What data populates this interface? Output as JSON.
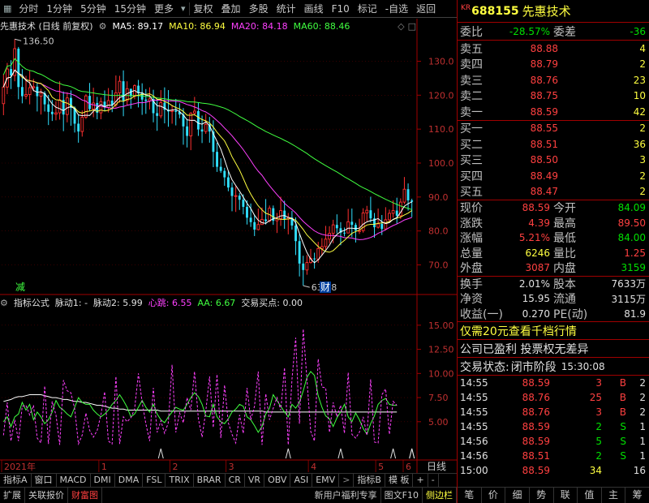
{
  "toolbar": {
    "buttons": [
      "分时",
      "1分钟",
      "5分钟",
      "15分钟",
      "更多",
      "复权",
      "叠加",
      "多股",
      "统计",
      "画线",
      "F10",
      "标记",
      "-自选",
      "返回"
    ]
  },
  "chart": {
    "title": "先惠技术 (日线 前复权)",
    "ma": [
      {
        "label": "MA5: 89.17",
        "color": "#ffffff"
      },
      {
        "label": "MA10: 86.94",
        "color": "#ffff40"
      },
      {
        "label": "MA20: 84.18",
        "color": "#ff40ff"
      },
      {
        "label": "MA60: 88.46",
        "color": "#40ff40"
      }
    ],
    "high_label": "136.50",
    "low_label": "63.88",
    "marker_left": "减",
    "marker_right": "财"
  },
  "sub_chart": {
    "title": "指标公式",
    "items": [
      {
        "label": "脉动1: -",
        "color": "#e0e0e0"
      },
      {
        "label": "脉动2: 5.99",
        "color": "#e0e0e0"
      },
      {
        "label": "心跳: 6.55",
        "color": "#ff40ff"
      },
      {
        "label": "AA: 6.67",
        "color": "#40ff40"
      },
      {
        "label": "交易买点: 0.00",
        "color": "#e0e0e0"
      }
    ]
  },
  "chart_data": {
    "type": "candlestick",
    "main_yaxis_ticks": [
      130,
      120,
      110,
      100,
      90,
      80,
      70
    ],
    "main_ylim": [
      62,
      138
    ],
    "sub_yaxis_ticks": [
      15,
      12.5,
      10,
      7.5,
      5
    ],
    "sub_ylim": [
      1.2,
      16.5
    ],
    "x_labels": [
      "2021年",
      "1",
      "2",
      "3",
      "4",
      "5",
      "6"
    ],
    "x_axis_label": "日线",
    "candles": [
      [
        117.5,
        122.4,
        126.2,
        114.1
      ],
      [
        122.4,
        127.7,
        129.5,
        120.3
      ],
      [
        127.7,
        125.8,
        130.3,
        121.8
      ],
      [
        125.8,
        133.7,
        136.5,
        124.1
      ],
      [
        133.7,
        122.4,
        134.2,
        118.8
      ],
      [
        122.4,
        119.7,
        127.7,
        117.6
      ],
      [
        119.7,
        120.2,
        125.7,
        118.8
      ],
      [
        120.2,
        122.2,
        127.3,
        117.3
      ],
      [
        122.2,
        122.5,
        124.8,
        121.1
      ],
      [
        122.5,
        119.7,
        123.6,
        115.2
      ],
      [
        119.7,
        120.6,
        121.9,
        114.3
      ],
      [
        120.6,
        117.3,
        121.2,
        115.2
      ],
      [
        117.3,
        115.1,
        120.1,
        111.2
      ],
      [
        115.1,
        114.4,
        118.6,
        112.4
      ],
      [
        114.4,
        114.8,
        118.2,
        112.6
      ],
      [
        114.8,
        118.6,
        124.1,
        112.8
      ],
      [
        118.6,
        114.3,
        121.1,
        109.4
      ],
      [
        114.3,
        119.2,
        120.8,
        112.0
      ],
      [
        119.2,
        116.3,
        121.4,
        111.0
      ],
      [
        116.3,
        111.6,
        116.7,
        109.0
      ],
      [
        111.6,
        109.3,
        114.2,
        106.0
      ],
      [
        109.3,
        113.5,
        115.5,
        107.8
      ],
      [
        113.5,
        119.8,
        120.3,
        113.0
      ],
      [
        119.8,
        115.9,
        123.6,
        115.3
      ],
      [
        115.9,
        117.7,
        122.2,
        113.5
      ],
      [
        117.7,
        114.8,
        119.5,
        112.9
      ],
      [
        114.8,
        118.1,
        119.3,
        112.9
      ],
      [
        118.1,
        116.4,
        121.4,
        115.4
      ],
      [
        116.4,
        118.4,
        122.1,
        114.9
      ],
      [
        118.4,
        117.1,
        121.5,
        115.0
      ],
      [
        117.1,
        120.7,
        125.8,
        116.4
      ],
      [
        120.7,
        124.1,
        125.7,
        117.8
      ],
      [
        124.1,
        118.4,
        127.3,
        113.8
      ],
      [
        118.4,
        121.9,
        124.1,
        117.1
      ],
      [
        121.9,
        119.7,
        121.6,
        116.0
      ],
      [
        119.7,
        122.8,
        123.2,
        118.8
      ],
      [
        122.8,
        120.6,
        124.5,
        116.4
      ],
      [
        120.6,
        118.7,
        123.5,
        114.2
      ],
      [
        118.7,
        118.3,
        121.8,
        114.5
      ],
      [
        118.3,
        118.9,
        122.3,
        115.8
      ],
      [
        118.9,
        114.7,
        121.6,
        112.0
      ],
      [
        114.7,
        113.9,
        119.0,
        109.5
      ],
      [
        113.9,
        117.8,
        121.5,
        113.2
      ],
      [
        117.8,
        115.7,
        122.3,
        111.7
      ],
      [
        115.7,
        115.2,
        121.5,
        110.7
      ],
      [
        115.2,
        115.5,
        117.1,
        111.6
      ],
      [
        115.5,
        115.1,
        118.9,
        111.1
      ],
      [
        115.1,
        114.3,
        117.6,
        113.2
      ],
      [
        114.3,
        110.8,
        116.2,
        105.4
      ],
      [
        110.8,
        108.0,
        113.0,
        104.6
      ],
      [
        108.0,
        114.7,
        115.0,
        103.8
      ],
      [
        114.7,
        115.3,
        119.5,
        114.0
      ],
      [
        115.3,
        109.9,
        117.9,
        108.0
      ],
      [
        109.9,
        109.3,
        114.0,
        105.9
      ],
      [
        109.3,
        111.4,
        114.5,
        108.6
      ],
      [
        111.4,
        109.3,
        113.6,
        106.0
      ],
      [
        109.3,
        103.3,
        112.6,
        98.8
      ],
      [
        103.3,
        98.9,
        106.0,
        97.4
      ],
      [
        98.9,
        97.7,
        101.4,
        97.1
      ],
      [
        97.7,
        95.8,
        98.6,
        93.3
      ],
      [
        95.8,
        92.8,
        97.5,
        91.7
      ],
      [
        92.8,
        90.3,
        94.3,
        85.8
      ],
      [
        90.3,
        90.4,
        93.2,
        85.6
      ],
      [
        90.4,
        89.2,
        91.2,
        86.2
      ],
      [
        89.2,
        87.1,
        90.8,
        84.9
      ],
      [
        87.1,
        83.9,
        89.0,
        81.9
      ],
      [
        83.9,
        82.6,
        88.1,
        81.2
      ],
      [
        82.6,
        80.4,
        84.7,
        78.5
      ],
      [
        80.4,
        81.9,
        86.6,
        80.2
      ],
      [
        81.9,
        83.4,
        86.9,
        81.8
      ],
      [
        83.4,
        82.9,
        89.4,
        81.9
      ],
      [
        82.9,
        86.7,
        87.5,
        82.5
      ],
      [
        86.7,
        83.0,
        87.5,
        81.8
      ],
      [
        83.0,
        83.6,
        85.3,
        79.4
      ],
      [
        83.6,
        86.0,
        90.1,
        81.5
      ],
      [
        86.0,
        83.5,
        88.9,
        80.6
      ],
      [
        83.5,
        83.9,
        85.3,
        79.0
      ],
      [
        83.9,
        81.6,
        85.9,
        80.4
      ],
      [
        81.6,
        77.0,
        84.0,
        72.9
      ],
      [
        77.0,
        70.4,
        79.0,
        66.6
      ],
      [
        70.4,
        68.5,
        72.7,
        63.9
      ],
      [
        68.5,
        70.7,
        72.9,
        67.1
      ],
      [
        70.7,
        71.9,
        74.7,
        70.4
      ],
      [
        71.9,
        71.7,
        73.6,
        68.9
      ],
      [
        71.7,
        74.8,
        76.8,
        70.6
      ],
      [
        74.8,
        75.4,
        77.9,
        72.7
      ],
      [
        75.4,
        77.6,
        81.5,
        74.4
      ],
      [
        77.6,
        79.3,
        81.4,
        76.3
      ],
      [
        79.3,
        81.8,
        83.3,
        76.4
      ],
      [
        81.8,
        80.8,
        84.9,
        79.3
      ],
      [
        80.8,
        79.5,
        82.6,
        75.8
      ],
      [
        79.5,
        79.4,
        81.0,
        78.4
      ],
      [
        79.4,
        82.7,
        86.5,
        80.1
      ],
      [
        82.7,
        81.8,
        86.6,
        78.2
      ],
      [
        81.8,
        80.1,
        82.4,
        76.6
      ],
      [
        80.1,
        80.1,
        83.6,
        79.1
      ],
      [
        80.1,
        85.3,
        86.7,
        79.5
      ],
      [
        85.3,
        86.1,
        87.4,
        82.8
      ],
      [
        86.1,
        83.7,
        90.1,
        82.5
      ],
      [
        83.7,
        81.1,
        85.3,
        78.0
      ],
      [
        81.1,
        82.1,
        86.6,
        80.7
      ],
      [
        82.1,
        80.6,
        84.7,
        78.8
      ],
      [
        80.6,
        83.3,
        87.0,
        80.2
      ],
      [
        83.3,
        85.2,
        86.3,
        82.5
      ],
      [
        85.2,
        86.0,
        89.0,
        83.9
      ],
      [
        86.0,
        84.5,
        89.8,
        82.1
      ],
      [
        84.5,
        88.5,
        89.6,
        83.5
      ],
      [
        88.5,
        92.3,
        95.9,
        87.9
      ],
      [
        92.3,
        89.0,
        94.0,
        86.0
      ],
      [
        89.0,
        88.6,
        89.5,
        84.1
      ]
    ],
    "ma5_color": "#ffffff",
    "ma10_color": "#ffff40",
    "ma20_color": "#ff40ff",
    "ma60_color": "#40ff40",
    "sub_series": {
      "xintiao": [
        3.6,
        7.0,
        3.0,
        5.2,
        3.0,
        6.6,
        6.7,
        5.7,
        6.7,
        3.3,
        2.8,
        8.7,
        2.7,
        7.1,
        5.7,
        2.6,
        9.3,
        8.2,
        8.0,
        6.3,
        2.7,
        3.6,
        5.9,
        4.1,
        3.4,
        4.1,
        5.7,
        8.1,
        3.0,
        2.7,
        9.7,
        2.7,
        5.5,
        5.0,
        5.4,
        6.3,
        10.0,
        7.0,
        4.8,
        3.0,
        8.5,
        3.9,
        5.1,
        3.8,
        4.9,
        10.9,
        3.9,
        5.9,
        4.9,
        7.5,
        6.2,
        10.2,
        5.3,
        3.4,
        6.1,
        9.7,
        4.4,
        9.9,
        3.3,
        8.8,
        4.9,
        3.7,
        2.8,
        5.7,
        3.8,
        8.5,
        5.2,
        6.6,
        10.2,
        2.6,
        7.9,
        5.2,
        6.4,
        7.5,
        6.2,
        10.6,
        2.6,
        9.4,
        13.7,
        4.8,
        14.6,
        9.3,
        4.0,
        3.0,
        11.5,
        8.6,
        8.5,
        3.9,
        7.0,
        5.5,
        6.7,
        3.8,
        10.1,
        3.7,
        3.3,
        3.9,
        5.5,
        3.6,
        9.4,
        2.9,
        2.8,
        7.8,
        8.4,
        3.7,
        7.1,
        6.7
      ],
      "aa": [
        5.0,
        5.5,
        4.5,
        5.5,
        5.8,
        7.0,
        6.2,
        6.8,
        5.2,
        6.0,
        5.5,
        4.8,
        5.2,
        6.0,
        7.2,
        6.5,
        6.2,
        5.8,
        5.5,
        6.5,
        7.5,
        7.0,
        6.8,
        6.8,
        6.2,
        5.8,
        5.5,
        5.8,
        6.2,
        6.8,
        7.2,
        7.8,
        7.2,
        6.5,
        5.5,
        5.8,
        6.5,
        7.2,
        6.5,
        6.0,
        6.8,
        5.8,
        5.2,
        4.9,
        5.5,
        6.0,
        6.5,
        6.3,
        6.2,
        6.8,
        7.5,
        8.0,
        7.6,
        6.8,
        5.6,
        5.5,
        6.8,
        5.5,
        5.0,
        4.8,
        5.3,
        6.0,
        6.3,
        6.8,
        6.6,
        5.5,
        5.2,
        4.6,
        3.9,
        4.5,
        5.8,
        6.4,
        7.8,
        7.2,
        6.6,
        6.0,
        5.5,
        6.8,
        6.4,
        7.0,
        8.2,
        9.6,
        10.2,
        9.8,
        7.7,
        6.5,
        5.6,
        5.3,
        4.5,
        5.4,
        6.0,
        6.8,
        5.5,
        5.0,
        5.9,
        5.2,
        4.3,
        3.7,
        4.8,
        5.6,
        6.8,
        7.2,
        7.4,
        6.8,
        6.7,
        6.7
      ],
      "maidong": [
        7.1,
        7.2,
        7.3,
        7.5,
        7.6,
        7.6,
        7.7,
        7.8,
        7.8,
        7.8,
        7.8,
        7.7,
        7.6,
        7.5,
        7.5,
        7.4,
        7.3,
        7.3,
        7.2,
        7.1,
        7.1,
        7.0,
        7.0,
        6.9,
        6.8,
        6.7,
        6.7,
        6.6,
        6.5,
        6.4,
        6.4,
        6.3,
        6.3,
        6.2,
        6.2,
        6.2,
        6.2,
        6.2,
        6.2,
        6.2,
        6.2,
        6.2,
        6.1,
        6.1,
        6.1,
        6.1,
        6.1,
        6.1,
        6.1,
        6.1,
        6.1,
        6.1,
        6.1,
        6.1,
        6.1,
        6.1,
        6.1,
        6.1,
        6.1,
        6.1,
        6.1,
        6.1,
        6.1,
        6.1,
        6.1,
        6.1,
        6.1,
        6.1,
        6.1,
        6.1,
        6.0,
        6.0,
        6.0,
        6.0,
        6.0,
        6.0,
        6.0,
        6.0,
        6.0,
        6.0,
        6.0,
        6.0,
        6.0,
        6.0,
        6.0,
        6.0,
        6.0,
        6.0,
        6.0,
        6.0,
        6.0,
        6.0,
        6.0,
        6.0,
        6.0,
        6.0,
        6.0,
        6.0,
        6.0,
        6.0,
        6.0,
        6.0,
        6.0,
        6.0,
        6.0,
        6.0
      ]
    }
  },
  "bottom_tabs_row1": [
    "指标A",
    "窗口",
    "MACD",
    "DMI",
    "DMA",
    "FSL",
    "TRIX",
    "BRAR",
    "CR",
    "VR",
    "OBV",
    "ASI",
    "EMV",
    "指标B",
    "模 板",
    "+",
    "-"
  ],
  "bottom_tabs_row2": [
    "扩展",
    "关联报价",
    "财富图",
    "新用户福利专享",
    "图文F10",
    "侧边栏"
  ],
  "panel": {
    "kr": "KR",
    "code": "688155",
    "name": "先惠技术",
    "weibi_label": "委比",
    "weibi_value": "-28.57%",
    "weicha_label": "委差",
    "weicha_value": "-36",
    "asks": [
      {
        "label": "卖五",
        "price": "88.88",
        "vol": "4"
      },
      {
        "label": "卖四",
        "price": "88.79",
        "vol": "2"
      },
      {
        "label": "卖三",
        "price": "88.76",
        "vol": "23"
      },
      {
        "label": "卖二",
        "price": "88.75",
        "vol": "10"
      },
      {
        "label": "卖一",
        "price": "88.59",
        "vol": "42"
      }
    ],
    "bids": [
      {
        "label": "买一",
        "price": "88.55",
        "vol": "2"
      },
      {
        "label": "买二",
        "price": "88.51",
        "vol": "36"
      },
      {
        "label": "买三",
        "price": "88.50",
        "vol": "3"
      },
      {
        "label": "买四",
        "price": "88.49",
        "vol": "2"
      },
      {
        "label": "买五",
        "price": "88.47",
        "vol": "2"
      }
    ],
    "quote": [
      {
        "l1": "现价",
        "v1": "88.59",
        "c1": "r",
        "l2": "今开",
        "v2": "84.09",
        "c2": "g"
      },
      {
        "l1": "涨跌",
        "v1": "4.39",
        "c1": "r",
        "l2": "最高",
        "v2": "89.50",
        "c2": "r"
      },
      {
        "l1": "涨幅",
        "v1": "5.21%",
        "c1": "r",
        "l2": "最低",
        "v2": "84.00",
        "c2": "g"
      },
      {
        "l1": "总量",
        "v1": "6246",
        "c1": "y",
        "l2": "量比",
        "v2": "1.25",
        "c2": "r"
      },
      {
        "l1": "外盘",
        "v1": "3087",
        "c1": "r",
        "l2": "内盘",
        "v2": "3159",
        "c2": "g"
      }
    ],
    "quote2": [
      {
        "l1": "换手",
        "v1": "2.01%",
        "l2": "股本",
        "v2": "7633万"
      },
      {
        "l1": "净资",
        "v1": "15.95",
        "l2": "流通",
        "v2": "3115万"
      },
      {
        "l1": "收益(一)",
        "v1": "0.270",
        "l2": "PE(动)",
        "v2": "81.9"
      }
    ],
    "promo": "仅需20元查看千档行情",
    "profit": "公司已盈利 投票权无差异",
    "status_label": "交易状态:",
    "status_value": "闭市阶段",
    "status_time": "15:30:08",
    "ticks": [
      {
        "t": "14:55",
        "p": "88.59",
        "v": "3",
        "bs": "B",
        "n": "2"
      },
      {
        "t": "14:55",
        "p": "88.76",
        "v": "25",
        "bs": "B",
        "n": "2"
      },
      {
        "t": "14:55",
        "p": "88.76",
        "v": "3",
        "bs": "B",
        "n": "2"
      },
      {
        "t": "14:55",
        "p": "88.59",
        "v": "2",
        "bs": "S",
        "n": "1"
      },
      {
        "t": "14:56",
        "p": "88.59",
        "v": "5",
        "bs": "S",
        "n": "1"
      },
      {
        "t": "14:56",
        "p": "88.51",
        "v": "2",
        "bs": "S",
        "n": "1"
      },
      {
        "t": "15:00",
        "p": "88.59",
        "v": "34",
        "bs": "",
        "n": "16"
      }
    ],
    "bottom_tabs": [
      "笔",
      "价",
      "细",
      "势",
      "联",
      "值",
      "主",
      "筹"
    ]
  }
}
